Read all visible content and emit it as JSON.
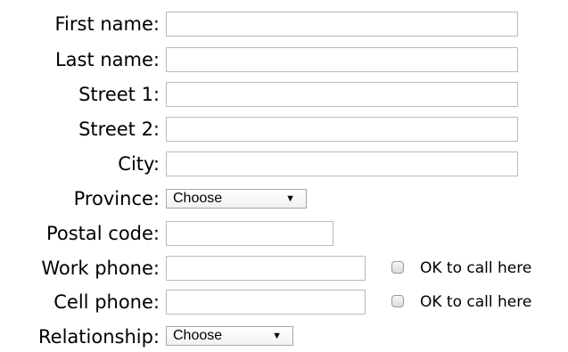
{
  "form": {
    "first_name": {
      "label": "First name:",
      "value": ""
    },
    "last_name": {
      "label": "Last name:",
      "value": ""
    },
    "street1": {
      "label": "Street 1:",
      "value": ""
    },
    "street2": {
      "label": "Street 2:",
      "value": ""
    },
    "city": {
      "label": "City:",
      "value": ""
    },
    "province": {
      "label": "Province:",
      "selected": "Choose",
      "arrow_icon": "triangle-down"
    },
    "postal_code": {
      "label": "Postal code:",
      "value": ""
    },
    "work_phone": {
      "label": "Work phone:",
      "value": "",
      "ok_to_call_label": "OK to call here",
      "ok_to_call_checked": false
    },
    "cell_phone": {
      "label": "Cell phone:",
      "value": "",
      "ok_to_call_label": "OK to call here",
      "ok_to_call_checked": false
    },
    "relationship": {
      "label": "Relationship:",
      "selected": "Choose",
      "arrow_icon": "triangle-down"
    }
  }
}
